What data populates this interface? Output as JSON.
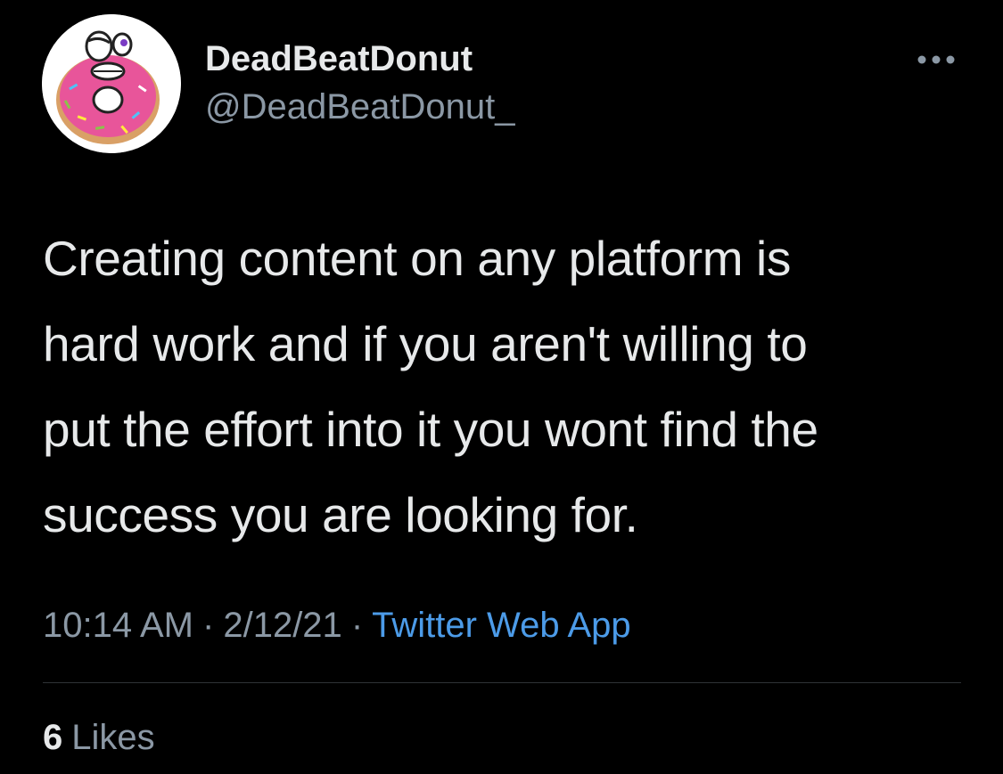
{
  "author": {
    "display_name": "DeadBeatDonut",
    "handle": "@DeadBeatDonut_",
    "avatar_icon": "pink-donut-avatar-icon"
  },
  "more_menu_icon": "more-dots-icon",
  "tweet": {
    "text_lines": [
      "Creating content on any platform is",
      "hard work and if you aren't willing to",
      "put the effort into it you wont find the",
      "success you are looking for."
    ],
    "time": "10:14 AM",
    "date": "2/12/21",
    "separator": "·",
    "source": "Twitter Web App"
  },
  "engagement": {
    "likes_count": "6",
    "likes_label": "Likes"
  },
  "colors": {
    "background": "#000000",
    "text": "#e7e9ea",
    "secondary": "#8b98a5",
    "link": "#4c9be8",
    "divider": "#2f3336",
    "donut_icing": "#e8559a"
  }
}
